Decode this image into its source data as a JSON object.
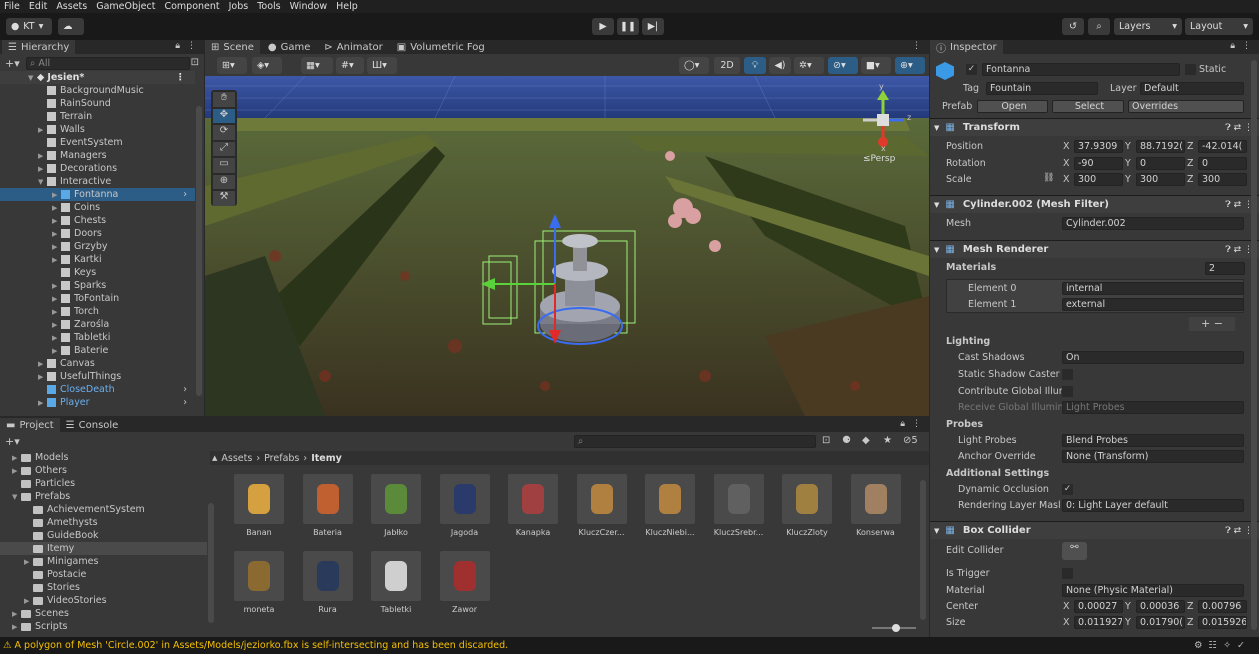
{
  "menu": [
    "File",
    "Edit",
    "Assets",
    "GameObject",
    "Component",
    "Jobs",
    "Tools",
    "Window",
    "Help"
  ],
  "toolbar": {
    "account": "KT",
    "layers": "Layers",
    "layout": "Layout"
  },
  "hierarchy": {
    "tab": "Hierarchy",
    "search": "All",
    "scene": "Jesien*",
    "items": [
      {
        "label": "BackgroundMusic",
        "indent": 2,
        "arrow": false,
        "icon": "cube"
      },
      {
        "label": "RainSound",
        "indent": 2,
        "arrow": false,
        "icon": "cube"
      },
      {
        "label": "Terrain",
        "indent": 2,
        "arrow": false,
        "icon": "cube"
      },
      {
        "label": "Walls",
        "indent": 2,
        "arrow": true,
        "icon": "cube"
      },
      {
        "label": "EventSystem",
        "indent": 2,
        "arrow": false,
        "icon": "cube"
      },
      {
        "label": "Managers",
        "indent": 2,
        "arrow": true,
        "icon": "cube"
      },
      {
        "label": "Decorations",
        "indent": 2,
        "arrow": true,
        "icon": "cube"
      },
      {
        "label": "Interactive",
        "indent": 2,
        "arrow": true,
        "open": true,
        "icon": "cube"
      },
      {
        "label": "Fontanna",
        "indent": 3,
        "arrow": true,
        "icon": "blue",
        "selected": true
      },
      {
        "label": "Coins",
        "indent": 3,
        "arrow": true,
        "icon": "cube"
      },
      {
        "label": "Chests",
        "indent": 3,
        "arrow": true,
        "icon": "cube"
      },
      {
        "label": "Doors",
        "indent": 3,
        "arrow": true,
        "icon": "cube"
      },
      {
        "label": "Grzyby",
        "indent": 3,
        "arrow": true,
        "icon": "cube"
      },
      {
        "label": "Kartki",
        "indent": 3,
        "arrow": true,
        "icon": "cube"
      },
      {
        "label": "Keys",
        "indent": 3,
        "arrow": false,
        "icon": "cube"
      },
      {
        "label": "Sparks",
        "indent": 3,
        "arrow": true,
        "icon": "cube"
      },
      {
        "label": "ToFontain",
        "indent": 3,
        "arrow": true,
        "icon": "cube"
      },
      {
        "label": "Torch",
        "indent": 3,
        "arrow": true,
        "icon": "cube"
      },
      {
        "label": "Zarośla",
        "indent": 3,
        "arrow": true,
        "icon": "cube"
      },
      {
        "label": "Tabletki",
        "indent": 3,
        "arrow": true,
        "icon": "cube"
      },
      {
        "label": "Baterie",
        "indent": 3,
        "arrow": true,
        "icon": "cube"
      },
      {
        "label": "Canvas",
        "indent": 2,
        "arrow": true,
        "icon": "cube"
      },
      {
        "label": "UsefulThings",
        "indent": 2,
        "arrow": true,
        "icon": "cube"
      },
      {
        "label": "CloseDeath",
        "indent": 2,
        "arrow": false,
        "icon": "blue",
        "blue": true
      },
      {
        "label": "Player",
        "indent": 2,
        "arrow": true,
        "icon": "blue",
        "blue": true
      }
    ]
  },
  "scene_tabs": [
    "Scene",
    "Game",
    "Animator",
    "Volumetric Fog"
  ],
  "scene": {
    "persp": "≤Persp",
    "mode2d": "2D",
    "axis_y": "y",
    "axis_x": "x",
    "axis_z": "z"
  },
  "project": {
    "tabs": [
      "Project",
      "Console"
    ],
    "count": "5",
    "breadcrumb": [
      "Assets",
      "Prefabs",
      "Itemy"
    ],
    "folders": [
      {
        "label": "Models",
        "indent": 1,
        "arrow": true
      },
      {
        "label": "Others",
        "indent": 1,
        "arrow": true
      },
      {
        "label": "Particles",
        "indent": 1,
        "arrow": false
      },
      {
        "label": "Prefabs",
        "indent": 1,
        "arrow": true,
        "open": true
      },
      {
        "label": "AchievementSystem",
        "indent": 2,
        "arrow": false
      },
      {
        "label": "Amethysts",
        "indent": 2,
        "arrow": false
      },
      {
        "label": "GuideBook",
        "indent": 2,
        "arrow": false
      },
      {
        "label": "Itemy",
        "indent": 2,
        "arrow": false,
        "selected": true
      },
      {
        "label": "Minigames",
        "indent": 2,
        "arrow": true
      },
      {
        "label": "Postacie",
        "indent": 2,
        "arrow": false
      },
      {
        "label": "Stories",
        "indent": 2,
        "arrow": false
      },
      {
        "label": "VideoStories",
        "indent": 2,
        "arrow": true
      },
      {
        "label": "Scenes",
        "indent": 1,
        "arrow": true
      },
      {
        "label": "Scripts",
        "indent": 1,
        "arrow": true
      }
    ],
    "assets": [
      "Banan",
      "Bateria",
      "Jabłko",
      "Jagoda",
      "Kanapka",
      "KluczCzer...",
      "KluczNiebi...",
      "KluczSrebr...",
      "KluczZloty",
      "Konserwa",
      "moneta",
      "Rura",
      "Tabletki",
      "Zawor"
    ]
  },
  "inspector": {
    "tab": "Inspector",
    "name": "Fontanna",
    "static": "Static",
    "tag_label": "Tag",
    "tag": "Fountain",
    "layer_label": "Layer",
    "layer": "Default",
    "prefab_label": "Prefab",
    "open": "Open",
    "select": "Select",
    "overrides": "Overrides",
    "transform": {
      "title": "Transform",
      "position_label": "Position",
      "rotation_label": "Rotation",
      "scale_label": "Scale",
      "position": [
        "37.9309",
        "88.7192(",
        "-42.014("
      ],
      "rotation": [
        "-90",
        "0",
        "0"
      ],
      "scale": [
        "300",
        "300",
        "300"
      ]
    },
    "mesh_filter": {
      "title": "Cylinder.002 (Mesh Filter)",
      "mesh_label": "Mesh",
      "mesh": "Cylinder.002"
    },
    "mesh_renderer": {
      "title": "Mesh Renderer",
      "materials_label": "Materials",
      "materials_count": "2",
      "elements": [
        {
          "label": "Element 0",
          "value": "internal"
        },
        {
          "label": "Element 1",
          "value": "external"
        }
      ],
      "lighting": "Lighting",
      "cast_shadows_label": "Cast Shadows",
      "cast_shadows": "On",
      "static_shadow": "Static Shadow Caster",
      "contribute_gi": "Contribute Global Illur",
      "receive_gi": "Receive Global Illumin",
      "receive_gi_value": "Light Probes",
      "probes": "Probes",
      "light_probes_label": "Light Probes",
      "light_probes": "Blend Probes",
      "anchor_label": "Anchor Override",
      "anchor": "None (Transform)",
      "additional": "Additional Settings",
      "dynamic_occlusion": "Dynamic Occlusion",
      "rendering_layer_label": "Rendering Layer Masl",
      "rendering_layer": "0: Light Layer default"
    },
    "box_collider": {
      "title": "Box Collider",
      "edit_label": "Edit Collider",
      "trigger_label": "Is Trigger",
      "material_label": "Material",
      "material": "None (Physic Material)",
      "center_label": "Center",
      "center": [
        "0.00027",
        "0.00036",
        "0.00796"
      ],
      "size_label": "Size",
      "size": [
        "0.011927",
        "0.01790(",
        "0.015926"
      ]
    }
  },
  "status": {
    "warning": "A polygon of Mesh 'Circle.002' in Assets/Models/jeziorko.fbx is self-intersecting and has been discarded."
  },
  "colors": {
    "accent": "#2c5d87",
    "warning": "#f5c000",
    "panel": "#383838"
  }
}
